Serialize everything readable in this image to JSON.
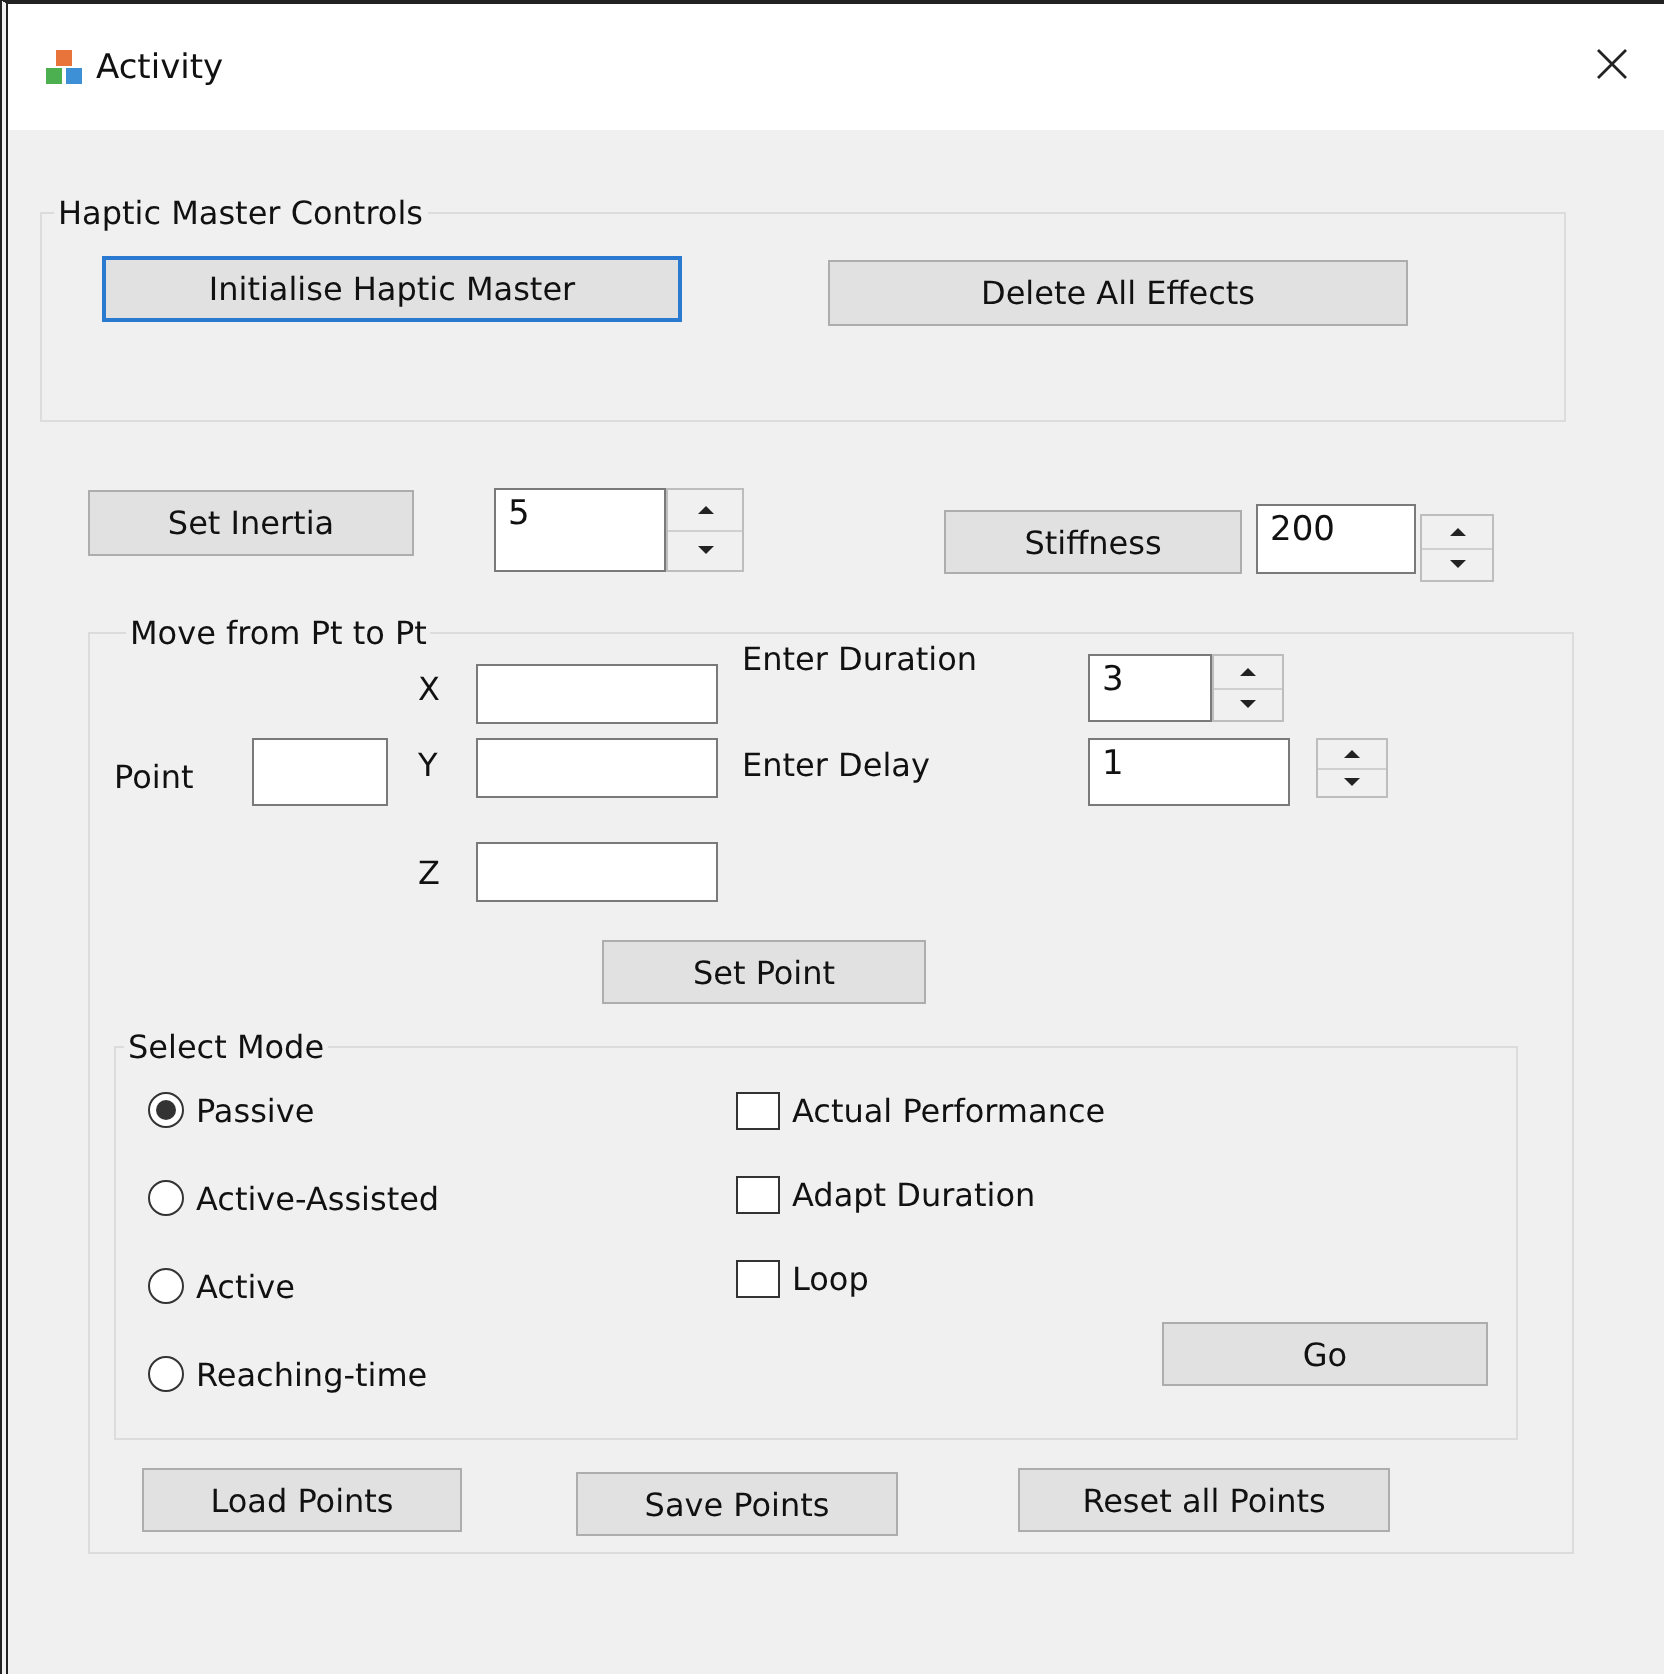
{
  "window": {
    "title": "Activity"
  },
  "haptic_group": {
    "title": "Haptic Master Controls",
    "buttons": [
      {
        "label": "Initialise Haptic Master",
        "focused": true
      },
      {
        "label": "Delete All Effects",
        "focused": false
      }
    ]
  },
  "inertia": {
    "button": "Set Inertia",
    "value": "5"
  },
  "stiffness": {
    "button": "Stiffness",
    "value": "200"
  },
  "move_group": {
    "title": "Move from Pt to Pt",
    "point_label": "Point",
    "coords": [
      {
        "label": "X"
      },
      {
        "label": "Y"
      },
      {
        "label": "Z"
      }
    ],
    "duration": {
      "label": "Enter Duration",
      "value": "3"
    },
    "delay": {
      "label": "Enter Delay",
      "value": "1"
    },
    "set_point": "Set Point",
    "mode_group": {
      "title": "Select Mode",
      "modes": [
        {
          "label": "Passive",
          "selected": true
        },
        {
          "label": "Active-Assisted",
          "selected": false
        },
        {
          "label": "Active",
          "selected": false
        },
        {
          "label": "Reaching-time",
          "selected": false
        }
      ],
      "options": [
        {
          "label": "Actual Performance",
          "checked": false
        },
        {
          "label": "Adapt Duration",
          "checked": false
        },
        {
          "label": "Loop",
          "checked": false
        }
      ],
      "go": "Go"
    },
    "buttons": [
      "Load Points",
      "Save Points",
      "Reset all Points"
    ]
  }
}
